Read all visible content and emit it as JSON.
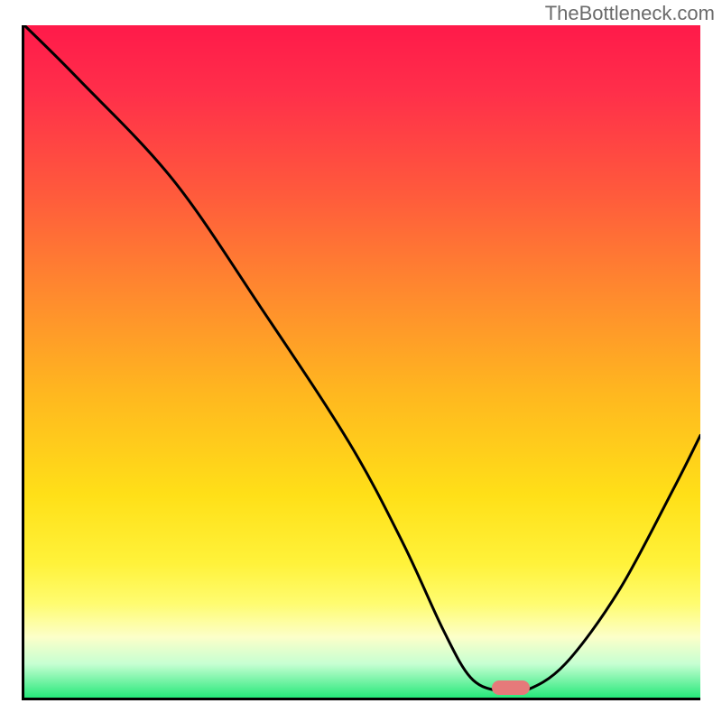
{
  "watermark": "TheBottleneck.com",
  "chart_data": {
    "type": "line",
    "title": "",
    "xlabel": "",
    "ylabel": "",
    "xlim": [
      0,
      100
    ],
    "ylim": [
      0,
      100
    ],
    "grid": false,
    "series": [
      {
        "name": "bottleneck-curve",
        "x": [
          0,
          8,
          22,
          35,
          48,
          56,
          62,
          66,
          70,
          74,
          80,
          88,
          96,
          100
        ],
        "values": [
          100,
          92,
          77,
          58,
          38,
          23,
          10,
          3,
          1,
          1,
          5,
          16,
          31,
          39
        ]
      }
    ],
    "marker": {
      "x": 72,
      "y": 1.5
    },
    "background_gradient": {
      "top_color": "#ff1a4a",
      "mid_color": "#ffe018",
      "bottom_color": "#26e87a"
    }
  }
}
